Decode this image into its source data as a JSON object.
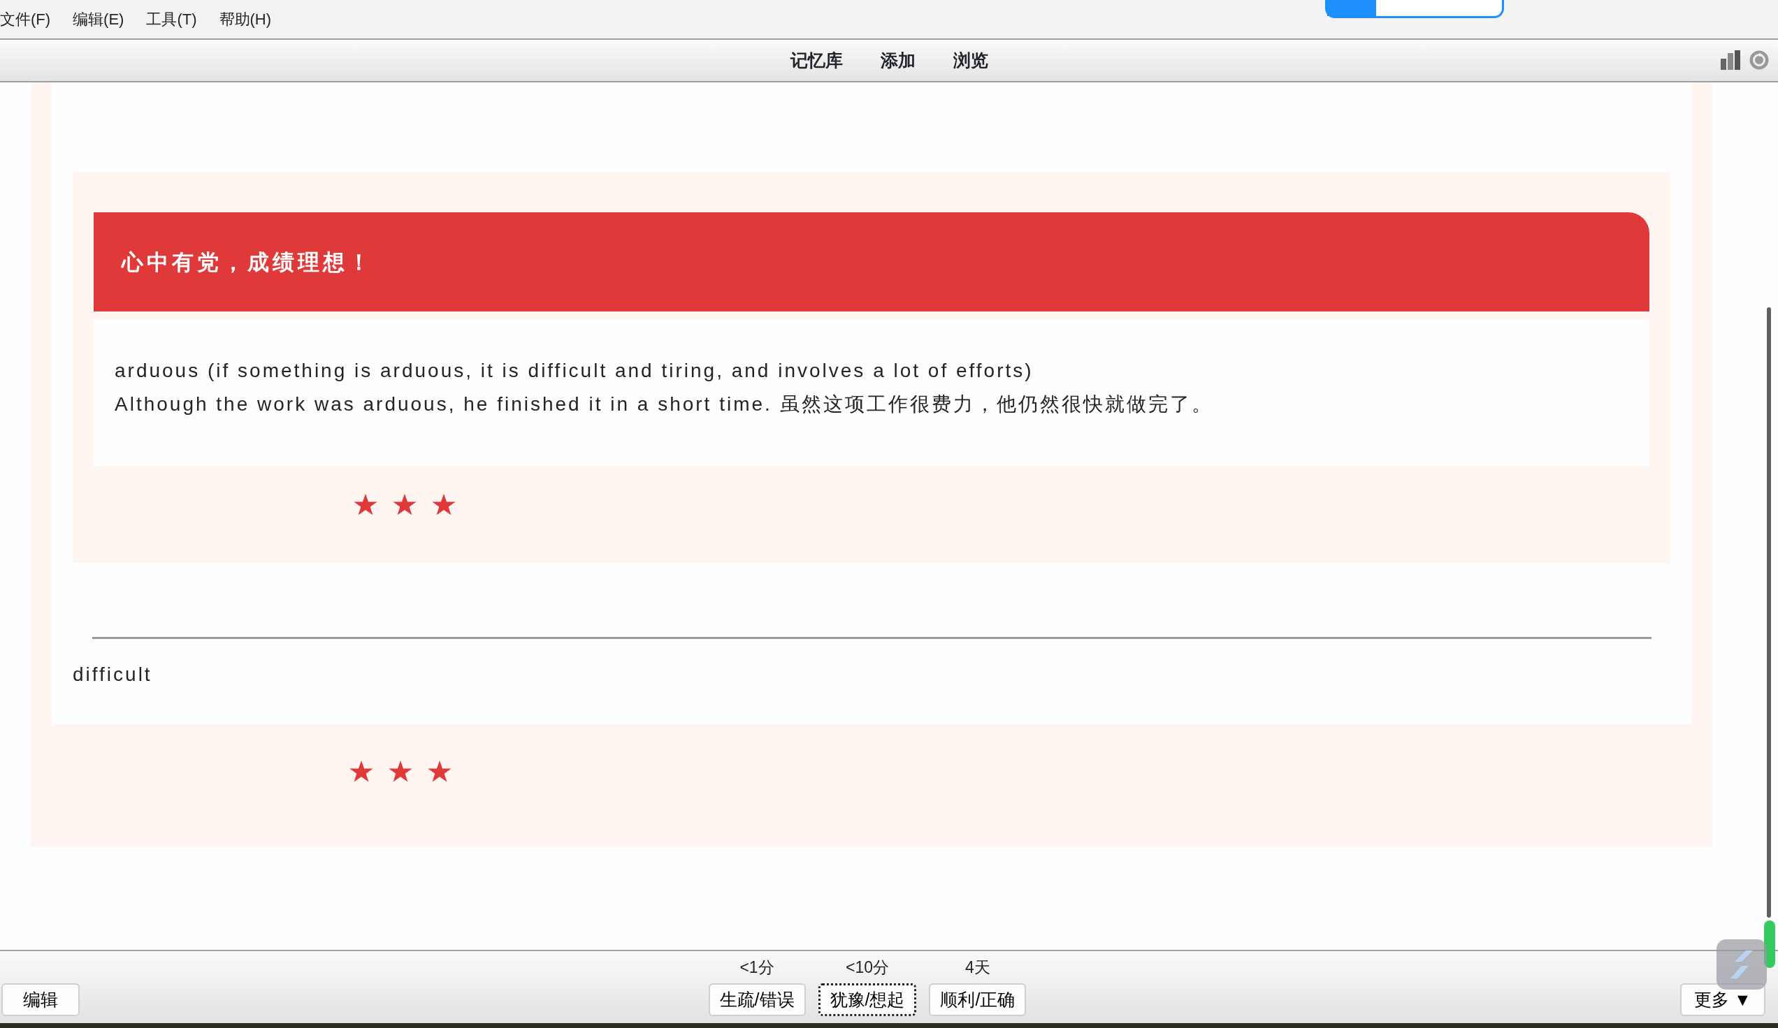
{
  "menu": [
    {
      "label": "文件(F)"
    },
    {
      "label": "编辑(E)"
    },
    {
      "label": "工具(T)"
    },
    {
      "label": "帮助(H)"
    }
  ],
  "toolbar": {
    "tabs": [
      {
        "label": "记忆库"
      },
      {
        "label": "添加"
      },
      {
        "label": "浏览"
      }
    ]
  },
  "card": {
    "header": "心中有党，成绩理想！",
    "lines": [
      "arduous (if something is arduous, it is difficult and tiring, and involves a lot of efforts)",
      "Although the work was arduous, he finished it in a short time. 虽然这项工作很费力，他仍然很快就做完了。"
    ],
    "stars": 3,
    "answer": "difficult",
    "footer": {
      "stars": 3
    }
  },
  "bottom_bar": {
    "edit_button": "编辑",
    "answers": [
      {
        "interval": "<1分",
        "label": "生疏/错误",
        "focused": false
      },
      {
        "interval": "<10分",
        "label": "犹豫/想起",
        "focused": true
      },
      {
        "interval": "4天",
        "label": "顺利/正确",
        "focused": false
      }
    ],
    "more_button": {
      "label": "更多",
      "arrow": "▼"
    }
  }
}
